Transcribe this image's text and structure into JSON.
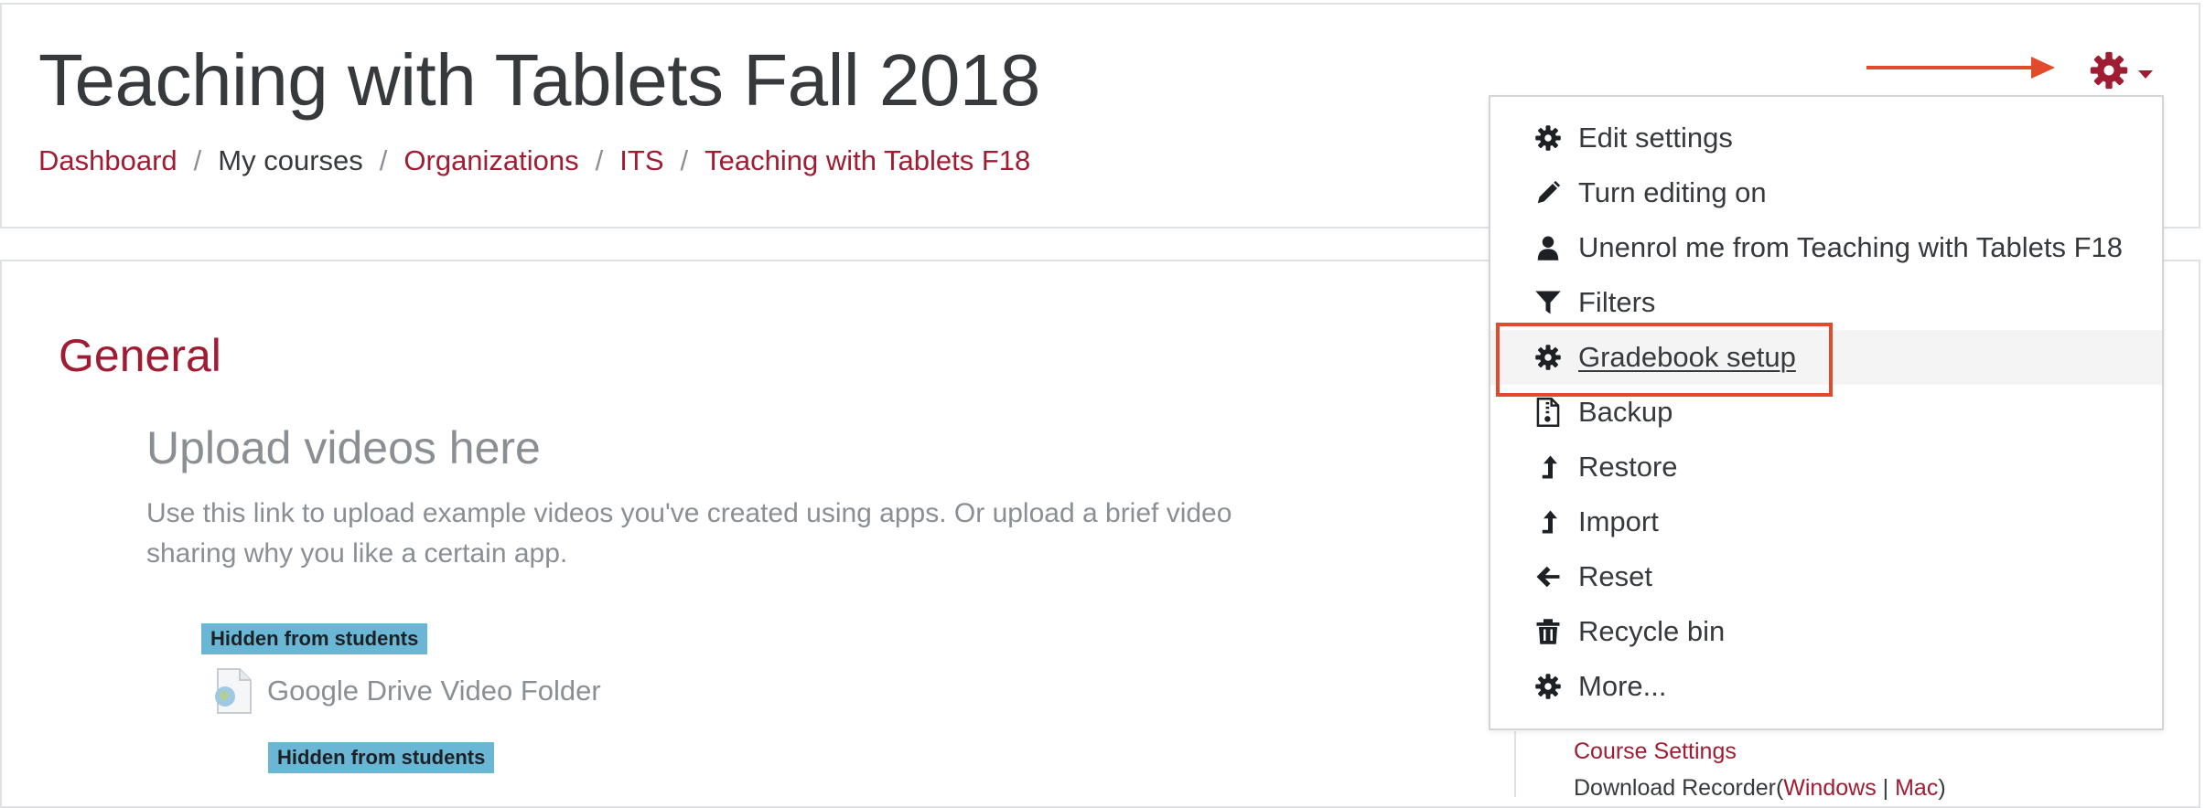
{
  "header": {
    "title": "Teaching with Tablets Fall 2018",
    "breadcrumb": [
      "Dashboard",
      "My courses",
      "Organizations",
      "ITS",
      "Teaching with Tablets F18"
    ]
  },
  "colors": {
    "brand": "#a01c32",
    "annotation": "#e24a2b",
    "badge": "#69b6d5"
  },
  "actions_menu": {
    "trigger_icon": "gear-icon",
    "items": [
      {
        "label": "Edit settings",
        "icon": "gear-icon"
      },
      {
        "label": "Turn editing on",
        "icon": "pencil-icon"
      },
      {
        "label": "Unenrol me from Teaching with Tablets F18",
        "icon": "user-icon"
      },
      {
        "label": "Filters",
        "icon": "filter-icon"
      },
      {
        "label": "Gradebook setup",
        "icon": "gear-icon",
        "highlighted": true
      },
      {
        "label": "Backup",
        "icon": "file-archive-icon"
      },
      {
        "label": "Restore",
        "icon": "level-up-icon"
      },
      {
        "label": "Import",
        "icon": "level-up-icon"
      },
      {
        "label": "Reset",
        "icon": "arrow-left-icon"
      },
      {
        "label": "Recycle bin",
        "icon": "trash-icon"
      },
      {
        "label": "More...",
        "icon": "gear-icon"
      }
    ]
  },
  "main": {
    "section_title": "General",
    "upload": {
      "title": "Upload videos here",
      "description": "Use this link to upload example videos you've created using apps. Or upload a brief video sharing why you like a certain app."
    },
    "badges": [
      "Hidden from students",
      "Hidden from students"
    ],
    "resource": {
      "name": "Google Drive Video Folder",
      "icon": "url-icon"
    }
  },
  "sidebar": {
    "course_settings": "Course Settings",
    "download_prefix": "Download Recorder(",
    "windows": "Windows",
    "separator": "|",
    "mac": "Mac",
    "suffix": ")"
  }
}
